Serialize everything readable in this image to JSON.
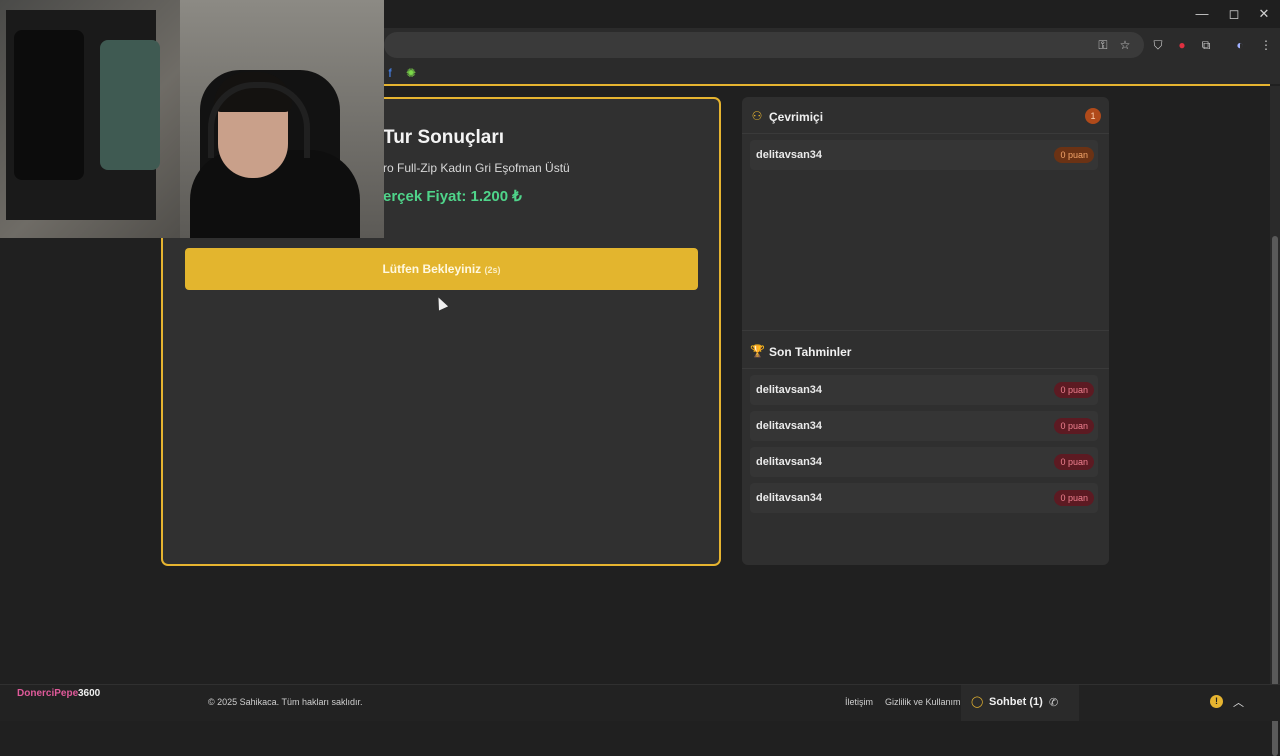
{
  "browser": {
    "controls": {
      "minimize": "—",
      "restore": "◻",
      "close": "✕"
    },
    "toolbar_icons": [
      "key-icon",
      "star-icon",
      "shield-icon",
      "record-icon",
      "extensions-icon",
      "profile-icon",
      "menu-icon"
    ]
  },
  "round_results": {
    "title": "Tur Sonuçları",
    "product": "ro Full-Zip Kadın Gri Eşofman Üstü",
    "price": "erçek Fiyat: 1.200 ₺",
    "wait_button": {
      "label": "Lütfen Bekleyiniz",
      "seconds": "(2s)"
    }
  },
  "online": {
    "title": "Çevrimiçi",
    "count": "1",
    "users": [
      {
        "name": "delitavsan34",
        "points": "0 puan"
      }
    ]
  },
  "recent_guesses": {
    "title": "Son Tahminler",
    "items": [
      {
        "name": "delitavsan34",
        "points": "0 puan"
      },
      {
        "name": "delitavsan34",
        "points": "0 puan"
      },
      {
        "name": "delitavsan34",
        "points": "0 puan"
      },
      {
        "name": "delitavsan34",
        "points": "0 puan"
      }
    ]
  },
  "stream_overlay": {
    "name": "DonerciPepe",
    "number": "3600"
  },
  "footer": {
    "copyright": "© 2025 Sahikaca. Tüm hakları saklıdır.",
    "links": [
      "İletişim",
      "Gizlilik ve Kullanım"
    ],
    "chat_label": "Sohbet (1)",
    "alert": "!"
  },
  "colors": {
    "accent": "#e6b430",
    "price": "#4fd48a",
    "points_red": "#f08090",
    "points_orange": "#f5a56a"
  }
}
